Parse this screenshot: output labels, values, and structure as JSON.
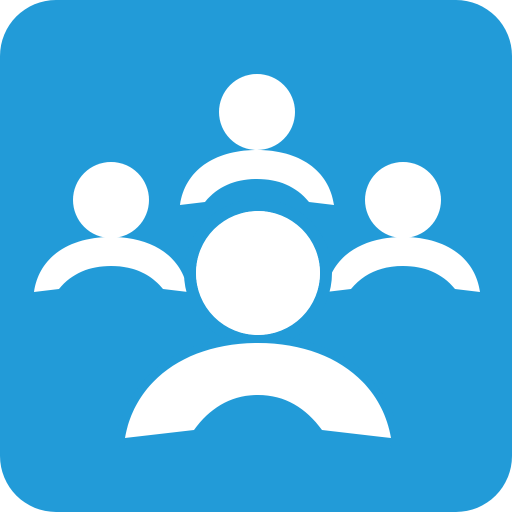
{
  "app_icon": {
    "icon": "group-icon",
    "background_color": "#229bd8",
    "glyph_color": "#ffffff",
    "people_count": 4
  }
}
